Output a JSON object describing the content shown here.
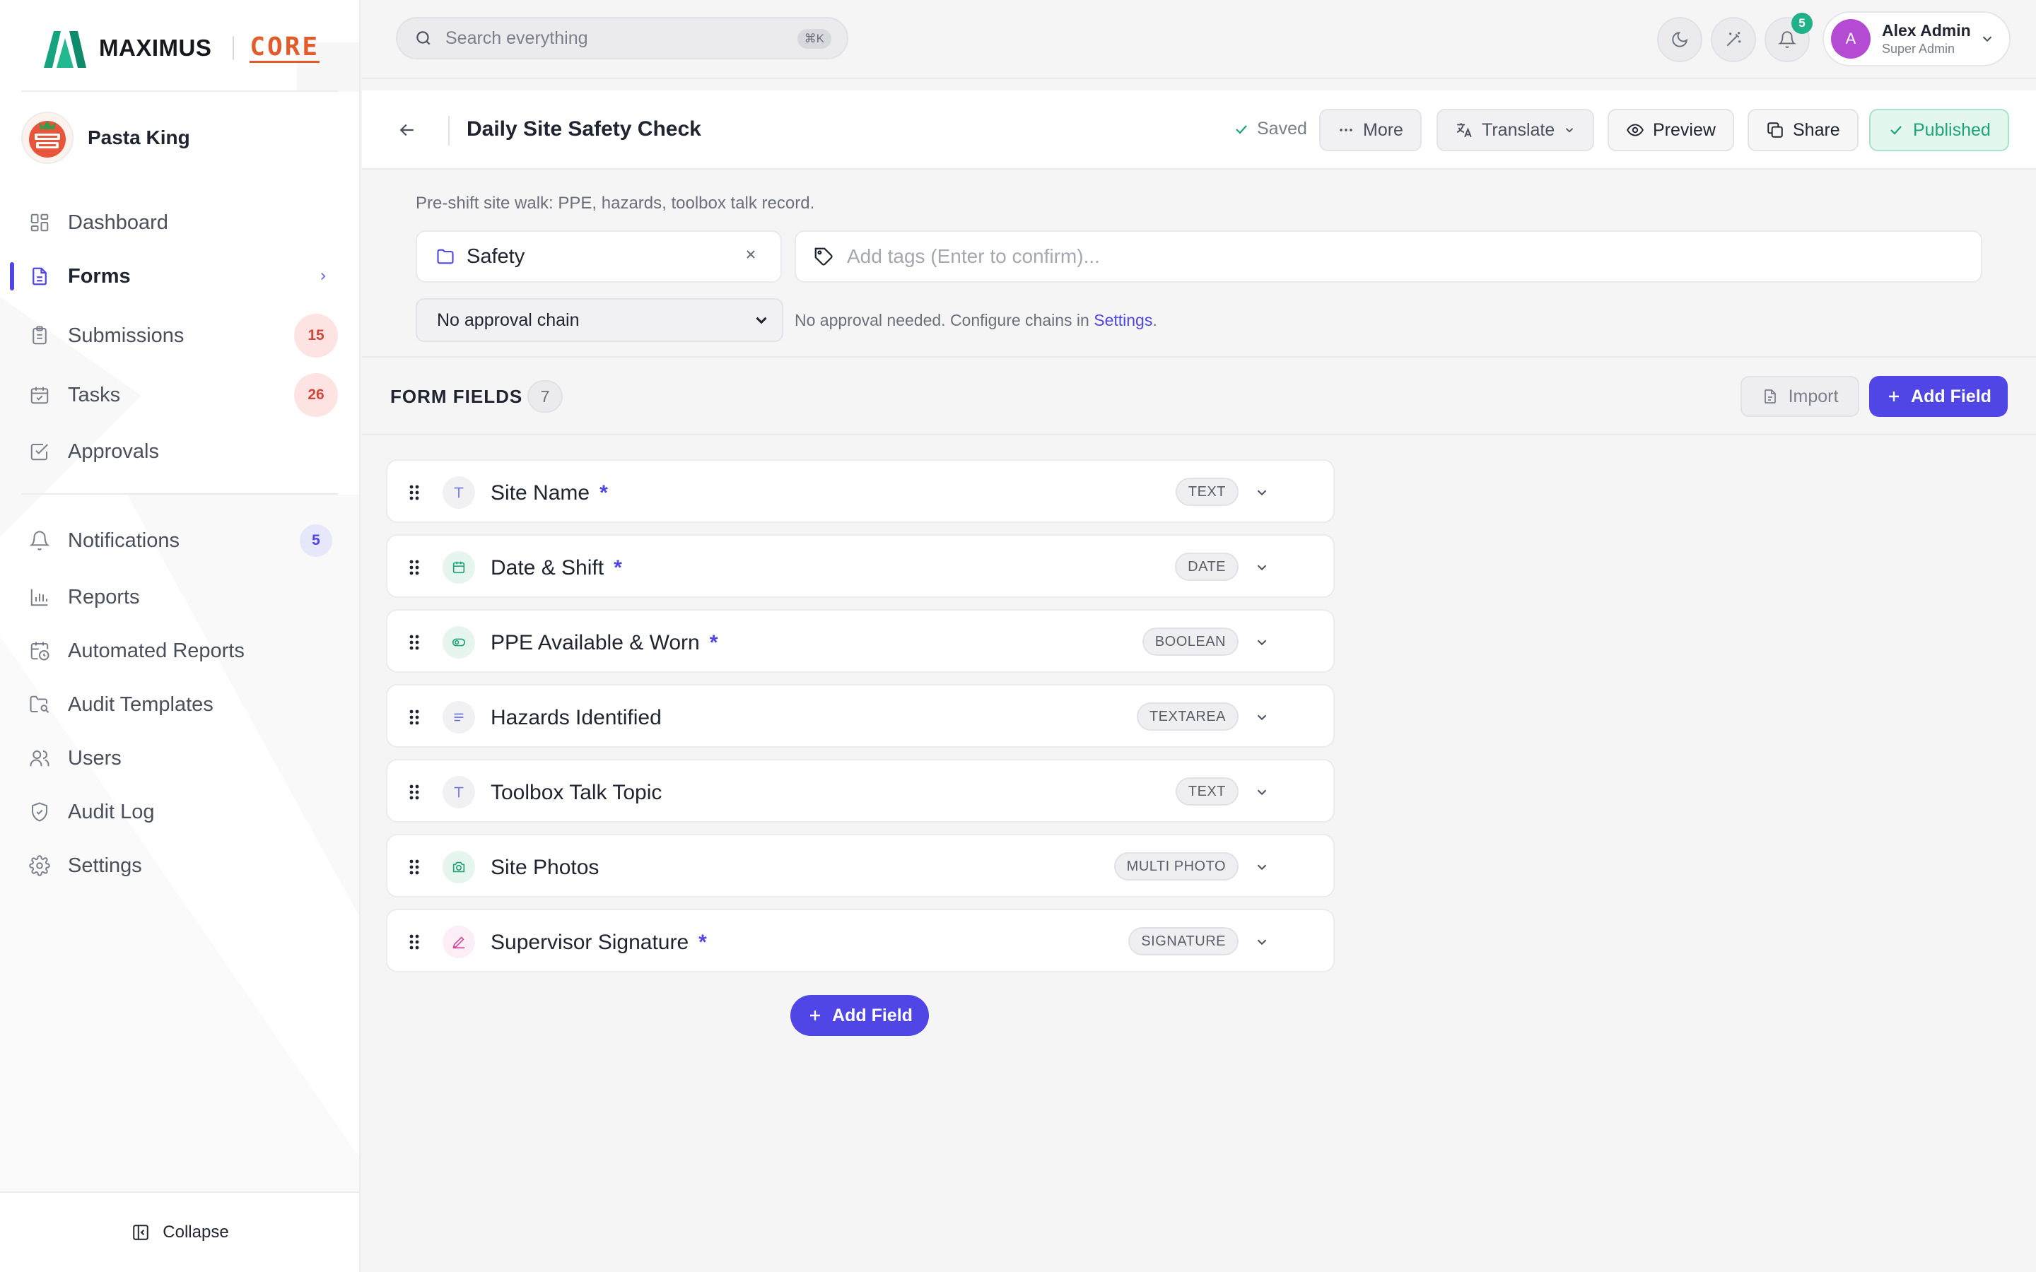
{
  "brand": {
    "name": "MAXIMUS",
    "product": "CORE"
  },
  "org": {
    "name": "Pasta King",
    "avatar_text": "PASTA KING"
  },
  "nav": {
    "items": [
      {
        "label": "Dashboard"
      },
      {
        "label": "Forms"
      },
      {
        "label": "Submissions",
        "badge": "15"
      },
      {
        "label": "Tasks",
        "badge": "26"
      },
      {
        "label": "Approvals"
      },
      {
        "label": "Notifications",
        "badge": "5"
      },
      {
        "label": "Reports"
      },
      {
        "label": "Automated Reports"
      },
      {
        "label": "Audit Templates"
      },
      {
        "label": "Users"
      },
      {
        "label": "Audit Log"
      },
      {
        "label": "Settings"
      }
    ],
    "active": "Forms",
    "collapse_label": "Collapse"
  },
  "topbar": {
    "search_placeholder": "Search everything",
    "search_shortcut": "⌘K",
    "notifications_count": "5",
    "user": {
      "name": "Alex Admin",
      "role": "Super Admin",
      "initial": "A"
    }
  },
  "header": {
    "title": "Daily Site Safety Check",
    "saved_label": "Saved",
    "more_label": "More",
    "translate_label": "Translate",
    "preview_label": "Preview",
    "share_label": "Share",
    "status_label": "Published"
  },
  "meta": {
    "description": "Pre-shift site walk: PPE, hazards, toolbox talk record.",
    "category": "Safety",
    "tags_placeholder": "Add tags (Enter to confirm)...",
    "approval_chain": "No approval chain",
    "approval_note": "No approval needed. Configure chains in ",
    "approval_link": "Settings",
    "approval_note_end": "."
  },
  "fields": {
    "title": "FORM FIELDS",
    "count": "7",
    "import_label": "Import",
    "add_label": "Add Field",
    "items": [
      {
        "label": "Site Name",
        "type": "TEXT",
        "required": true,
        "icon": "text-type-icon"
      },
      {
        "label": "Date & Shift",
        "type": "DATE",
        "required": true,
        "icon": "calendar-icon"
      },
      {
        "label": "PPE Available & Worn",
        "type": "BOOLEAN",
        "required": true,
        "icon": "toggle-icon"
      },
      {
        "label": "Hazards Identified",
        "type": "TEXTAREA",
        "required": false,
        "icon": "paragraph-icon"
      },
      {
        "label": "Toolbox Talk Topic",
        "type": "TEXT",
        "required": false,
        "icon": "text-type-icon"
      },
      {
        "label": "Site Photos",
        "type": "MULTI PHOTO",
        "required": false,
        "icon": "camera-icon"
      },
      {
        "label": "Supervisor Signature",
        "type": "SIGNATURE",
        "required": true,
        "icon": "pen-icon"
      }
    ],
    "required_marker": "*"
  },
  "colors": {
    "accent": "#4f46e5",
    "success": "#1fa37a",
    "danger_badge": "#d2473b",
    "brand_core": "#e25b2a",
    "brand_mark": "#1fa37a"
  }
}
